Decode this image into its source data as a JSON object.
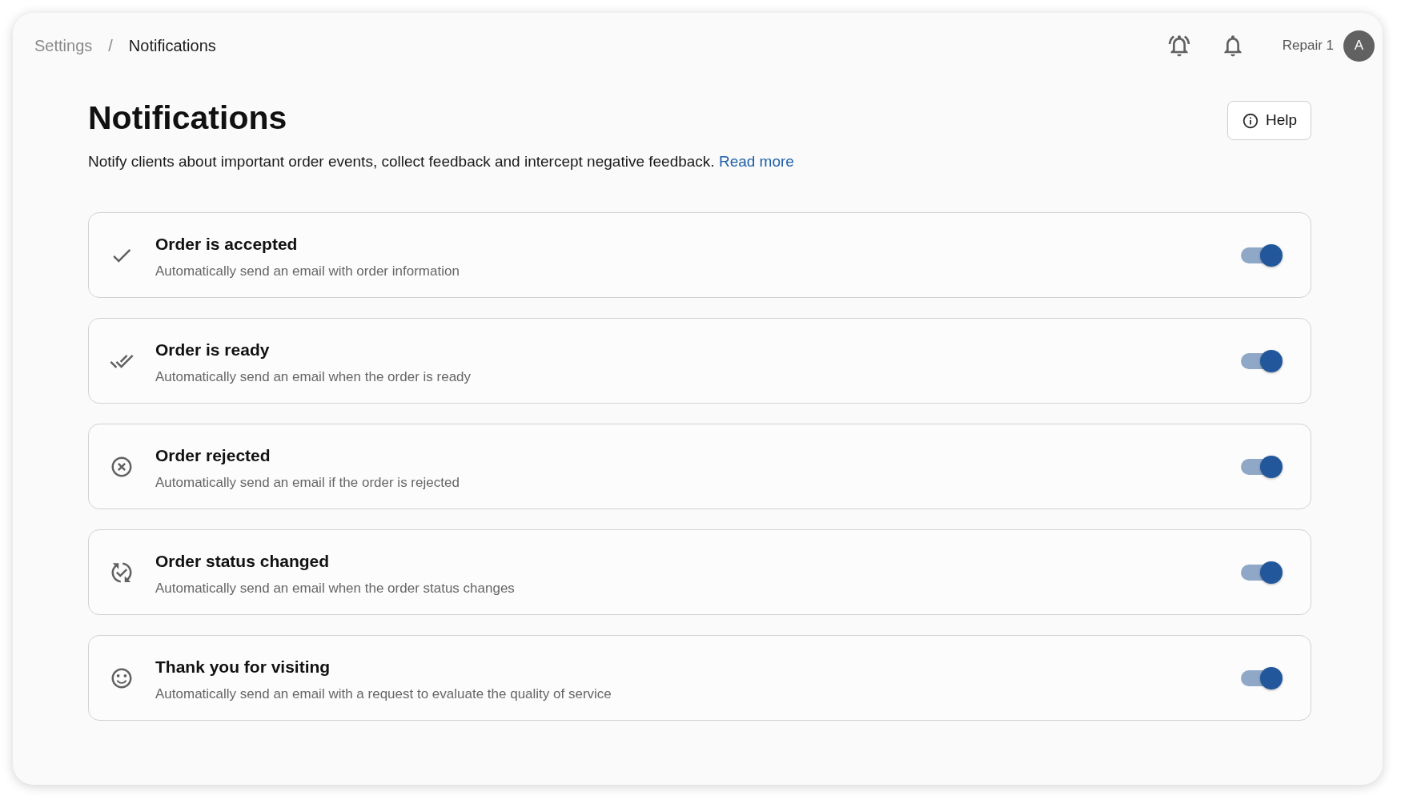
{
  "breadcrumb": {
    "items": [
      {
        "label": "Settings",
        "selected": false
      },
      {
        "label": "Notifications",
        "selected": true
      }
    ],
    "separator": "/"
  },
  "user": {
    "name": "Repair 1",
    "avatar_initial": "A"
  },
  "page": {
    "title": "Notifications",
    "description": "Notify clients about important order events, collect feedback and intercept negative feedback.",
    "read_more_link": "Read more",
    "help_button": "Help"
  },
  "notifications": [
    {
      "kind": "check",
      "title": "Order is accepted",
      "description": "Automatically send an email with order information",
      "on": true
    },
    {
      "kind": "checks",
      "title": "Order is ready",
      "description": "Automatically send an email when the order is ready",
      "on": true
    },
    {
      "kind": "cancel",
      "title": "Order rejected",
      "description": "Automatically send an email if the order is rejected",
      "on": true
    },
    {
      "kind": "sync",
      "title": "Order status changed",
      "description": "Automatically send an email when the order status changes",
      "on": true
    },
    {
      "kind": "smile",
      "title": "Thank you for visiting",
      "description": "Automatically send an email with a request to evaluate the quality of service",
      "on": true
    }
  ]
}
